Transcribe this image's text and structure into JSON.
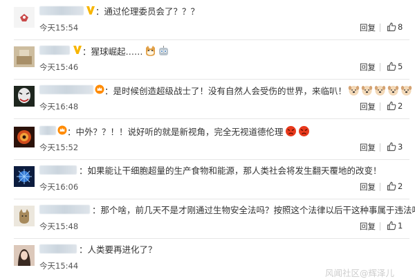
{
  "comments": [
    {
      "text": "：通过伦理委员会了？？？",
      "time": "今天15:54",
      "reply": "回复",
      "likes": "8"
    },
    {
      "text": "：猩球崛起……",
      "time": "今天15:46",
      "reply": "回复",
      "likes": "5"
    },
    {
      "text": "：是时候创造超级战士了！没有自然人会受伤的世界，来临叭！",
      "time": "今天16:48",
      "reply": "回复",
      "likes": "2"
    },
    {
      "text": "：中外？？！！说好听的就是新视角，完全无视道德伦理",
      "time": "今天15:52",
      "reply": "回复",
      "likes": "3"
    },
    {
      "text": "：如果能让干细胞超量的生产食物和能源，那人类社会将发生翻天覆地的改变！",
      "time": "今天16:06",
      "reply": "回复",
      "likes": "2"
    },
    {
      "text": "：那个啥，前几天不是才刚通过生物安全法吗？按照这个法律以后干这种事属于违法吧？",
      "time": "今天15:48",
      "reply": "回复",
      "likes": "1"
    },
    {
      "text": "：人类要再进化了？",
      "time": "今天15:44",
      "reply": "回复",
      "likes": ""
    }
  ],
  "watermark": "风闻社区@辉泽儿",
  "colors": {
    "text": "#333333",
    "time": "#555555",
    "separator": "#e6e6e6",
    "vip_badge": "#f7b500",
    "level_badge": "#ff8a00"
  },
  "icons": {
    "like": "thumb-up-icon",
    "vip": "vip-v-icon",
    "level": "crown-badge-icon",
    "emoji_dog": "dog-face-emoji-icon",
    "emoji_angry": "angry-face-emoji-icon",
    "emoji_cat": "cat-face-emoji-icon",
    "emoji_robot": "robot-face-emoji-icon"
  }
}
